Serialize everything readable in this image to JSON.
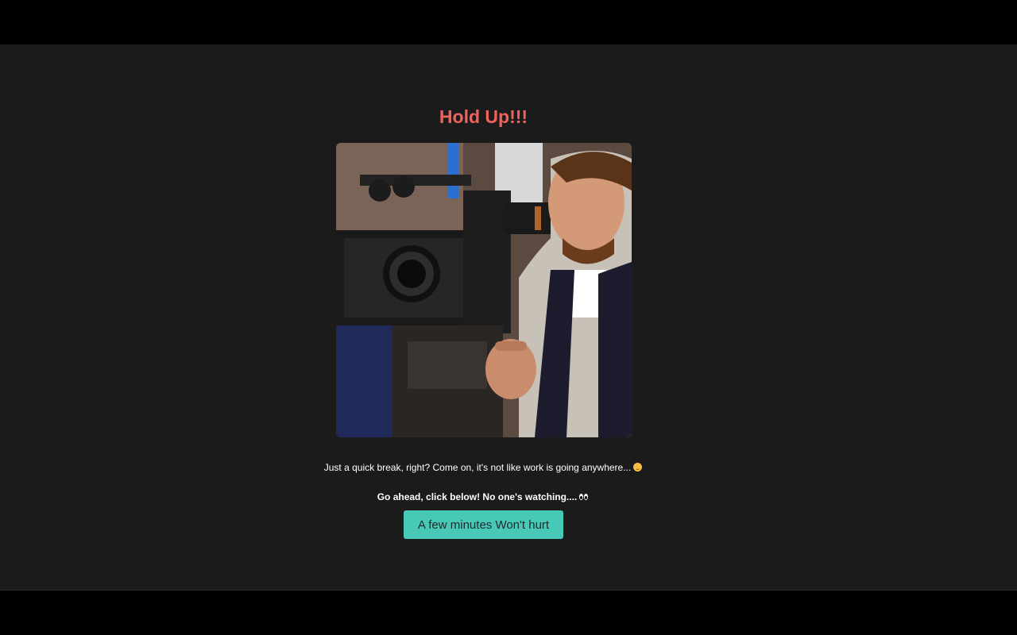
{
  "page": {
    "heading": "Hold Up!!!",
    "message_line": "Just a quick break, right? Come on, it's not like work is going anywhere...",
    "message_emoji_icon": "smirking-face-icon",
    "prompt_line": "Go ahead, click below! No one's watching....",
    "prompt_emoji_icon": "eyes-icon",
    "button_label": "A few minutes Won't hurt",
    "image_alt": "Man looking through a film camera eyepiece"
  },
  "colors": {
    "background": "#1b1b1b",
    "heading": "#f0625c",
    "button": "#48c9b7",
    "text": "#ffffff"
  }
}
